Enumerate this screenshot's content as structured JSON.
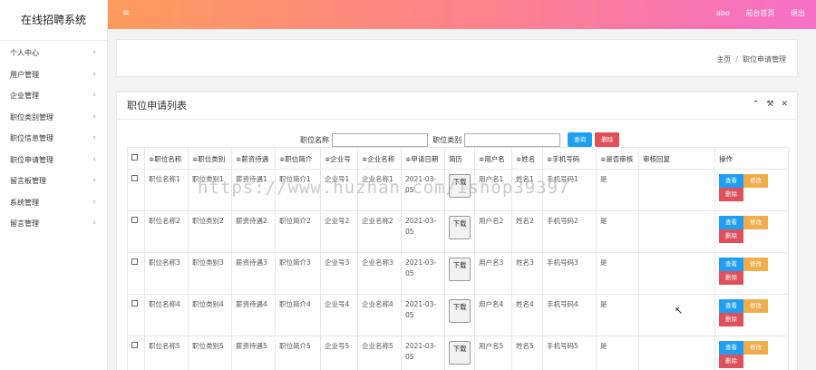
{
  "sidebar": {
    "title": "在线招聘系统",
    "items": [
      {
        "label": "个人中心"
      },
      {
        "label": "用户管理"
      },
      {
        "label": "企业管理"
      },
      {
        "label": "职位类别管理"
      },
      {
        "label": "职位信息管理"
      },
      {
        "label": "职位申请管理"
      },
      {
        "label": "留言板管理"
      },
      {
        "label": "系统管理"
      },
      {
        "label": "留言管理"
      }
    ],
    "chevron": "‹"
  },
  "topbar": {
    "menu_icon": "≡",
    "user": "abo",
    "home_link": "前台首页",
    "logout": "退出"
  },
  "breadcrumb": {
    "home": "主页",
    "sep": "/",
    "current": "职位申请管理"
  },
  "panel": {
    "title": "职位申请列表",
    "tools": [
      "⌃",
      "⚒",
      "✕"
    ]
  },
  "search": {
    "field1_label": "职位名称",
    "field2_label": "职位类别",
    "query_button": "查询",
    "delete_button": "删除"
  },
  "table": {
    "headers": [
      "",
      "≑职位名称",
      "≑职位类别",
      "≑薪资待遇",
      "≑职位简介",
      "≑企业号",
      "≑企业名称",
      "≑申请日期",
      "简历",
      "≑用户名",
      "≑姓名",
      "≑手机号码",
      "≑是否审核",
      "审核回复",
      "操作"
    ],
    "resume_button": "下载",
    "actions": {
      "view": "查看",
      "edit": "修改",
      "delete": "删除"
    },
    "rows": [
      {
        "name": "职位名称1",
        "type": "职位类别1",
        "salary": "薪资待遇1",
        "intro": "职位简介1",
        "company_no": "企业号1",
        "company": "企业名称1",
        "date": "2021-03-05",
        "username": "用户名1",
        "realname": "姓名1",
        "phone": "手机号码1",
        "reviewed": "是",
        "reply": ""
      },
      {
        "name": "职位名称2",
        "type": "职位类别2",
        "salary": "薪资待遇2",
        "intro": "职位简介2",
        "company_no": "企业号2",
        "company": "企业名称2",
        "date": "2021-03-05",
        "username": "用户名2",
        "realname": "姓名2",
        "phone": "手机号码2",
        "reviewed": "是",
        "reply": ""
      },
      {
        "name": "职位名称3",
        "type": "职位类别3",
        "salary": "薪资待遇3",
        "intro": "职位简介3",
        "company_no": "企业号3",
        "company": "企业名称3",
        "date": "2021-03-05",
        "username": "用户名3",
        "realname": "姓名3",
        "phone": "手机号码3",
        "reviewed": "是",
        "reply": ""
      },
      {
        "name": "职位名称4",
        "type": "职位类别4",
        "salary": "薪资待遇4",
        "intro": "职位简介4",
        "company_no": "企业号4",
        "company": "企业名称4",
        "date": "2021-03-05",
        "username": "用户名4",
        "realname": "姓名4",
        "phone": "手机号码4",
        "reviewed": "是",
        "reply": ""
      },
      {
        "name": "职位名称5",
        "type": "职位类别5",
        "salary": "薪资待遇5",
        "intro": "职位简介5",
        "company_no": "企业号5",
        "company": "企业名称5",
        "date": "2021-03-05",
        "username": "用户名5",
        "realname": "姓名5",
        "phone": "手机号码5",
        "reviewed": "是",
        "reply": ""
      }
    ]
  },
  "watermark": "https://www.huzhan.com/ishop39397",
  "colors": {
    "topbar_start": "#ff9a5c",
    "topbar_end": "#f66fc8",
    "view": "#1e9ff2",
    "edit": "#f0ad4e",
    "delete": "#e0505a"
  }
}
